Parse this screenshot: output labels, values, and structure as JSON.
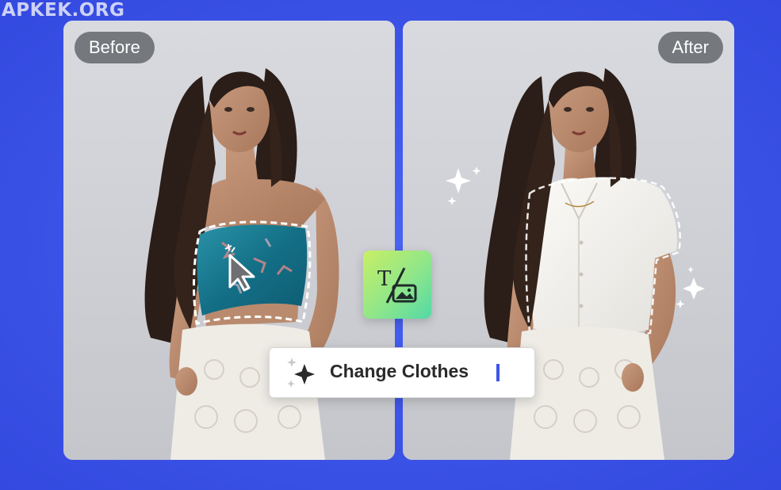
{
  "watermark": "APKEK.ORG",
  "panels": {
    "before_label": "Before",
    "after_label": "After"
  },
  "prompt": {
    "text": "Change Clothes"
  },
  "icons": {
    "text_to_image": "text-to-image-icon",
    "sparkle": "sparkle-icon",
    "cursor": "cursor-arrow-icon"
  },
  "colors": {
    "background": "#3d56ea",
    "caret": "#3d56ea",
    "icon_gradient_start": "#c9ef65",
    "icon_gradient_end": "#52d9a6",
    "top_color": "#1e7f96",
    "shirt_color": "#f4f3ef"
  }
}
